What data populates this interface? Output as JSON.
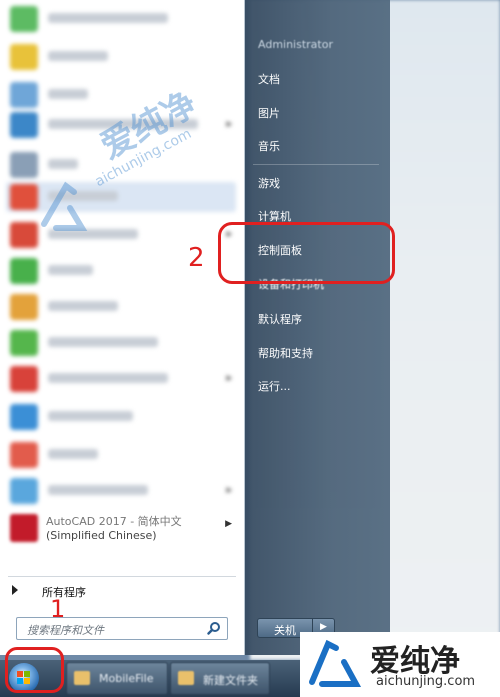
{
  "start_menu": {
    "user_name": "Administrator",
    "right_items": [
      "文档",
      "图片",
      "音乐",
      "游戏",
      "计算机",
      "控制面板",
      "设备和打印机",
      "默认程序",
      "帮助和支持",
      "运行..."
    ],
    "autocad": {
      "line1": "AutoCAD 2017 - 简体中文",
      "line2": "(Simplified Chinese)"
    },
    "all_programs": "所有程序",
    "search_placeholder": "搜索程序和文件",
    "shutdown_label": "关机"
  },
  "taskbar": {
    "buttons": [
      "MobileFile",
      "新建文件夹"
    ]
  },
  "annotations": {
    "step1": "1",
    "step2": "2"
  },
  "watermark": {
    "brand_cn": "爱纯净",
    "brand_url": "aichunjing.com"
  },
  "colors": {
    "annotation_red": "#e02020",
    "right_pane": "#3f566c",
    "watermark_blue": "#4c8ed0"
  },
  "icons": [
    "search-icon",
    "windows-start-orb",
    "folder-icon",
    "chevron-right-icon",
    "triangle-right-icon"
  ]
}
